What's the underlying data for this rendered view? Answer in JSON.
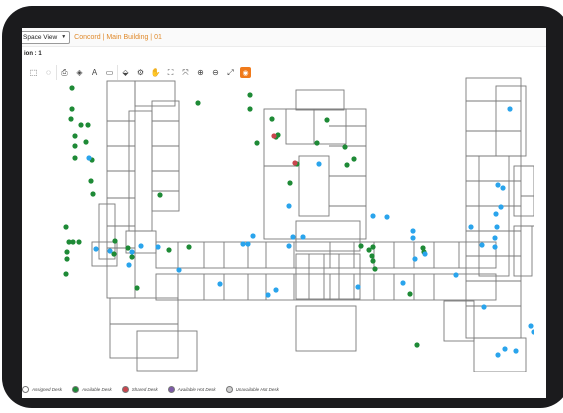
{
  "header": {
    "view_select": "Space View",
    "breadcrumb": "Concord | Main Building | 01"
  },
  "subbar": {
    "label": "ion : 1"
  },
  "toolbar": {
    "tools": [
      {
        "name": "select-tool-icon",
        "glyph": "⬚"
      },
      {
        "name": "rotate-tool-icon",
        "glyph": "◌"
      },
      {
        "name": "print-icon",
        "glyph": "⎙"
      },
      {
        "name": "layers-icon",
        "glyph": "◈"
      },
      {
        "name": "text-tool-icon",
        "glyph": "A"
      },
      {
        "name": "measure-tool-icon",
        "glyph": "▭"
      },
      {
        "name": "fill-tool-icon",
        "glyph": "⬙"
      },
      {
        "name": "settings-icon",
        "glyph": "⚙"
      },
      {
        "name": "pan-hand-icon",
        "glyph": "✋"
      },
      {
        "name": "fit-view-icon",
        "glyph": "⛶"
      },
      {
        "name": "fit-selection-icon",
        "glyph": "⤧"
      },
      {
        "name": "zoom-in-icon",
        "glyph": "⊕"
      },
      {
        "name": "zoom-out-icon",
        "glyph": "⊖"
      },
      {
        "name": "fullscreen-icon",
        "glyph": "⤢"
      },
      {
        "name": "layer-highlight-icon",
        "glyph": "◉"
      }
    ]
  },
  "colors": {
    "available": "#1e8a36",
    "shared": "#c8464e",
    "hot": "#7c5aa8",
    "unavailable": "#cfcfcf",
    "blue_desk": "#2aa4ec",
    "accent": "#f07a1b"
  },
  "desks": {
    "green": [
      [
        58,
        32
      ],
      [
        58,
        53
      ],
      [
        57,
        63
      ],
      [
        67,
        69
      ],
      [
        74,
        69
      ],
      [
        61,
        80
      ],
      [
        72,
        86
      ],
      [
        61,
        90
      ],
      [
        61,
        102
      ],
      [
        78,
        104
      ],
      [
        77,
        125
      ],
      [
        79,
        138
      ],
      [
        52,
        171
      ],
      [
        55,
        186
      ],
      [
        59,
        186
      ],
      [
        65,
        186
      ],
      [
        53,
        196
      ],
      [
        53,
        203
      ],
      [
        52,
        218
      ],
      [
        101,
        185
      ],
      [
        100,
        198
      ],
      [
        114,
        192
      ],
      [
        118,
        201
      ],
      [
        123,
        232
      ],
      [
        146,
        139
      ],
      [
        155,
        194
      ],
      [
        175,
        191
      ],
      [
        184,
        47
      ],
      [
        236,
        39
      ],
      [
        236,
        53
      ],
      [
        243,
        87
      ],
      [
        264,
        79
      ],
      [
        283,
        108
      ],
      [
        276,
        127
      ],
      [
        313,
        64
      ],
      [
        303,
        87
      ],
      [
        331,
        91
      ],
      [
        333,
        109
      ],
      [
        340,
        103
      ],
      [
        347,
        190
      ],
      [
        355,
        194
      ],
      [
        358,
        200
      ],
      [
        359,
        205
      ],
      [
        361,
        213
      ],
      [
        359,
        191
      ],
      [
        396,
        238
      ],
      [
        403,
        289
      ],
      [
        409,
        192
      ],
      [
        410,
        196
      ],
      [
        258,
        63
      ],
      [
        262,
        81
      ]
    ],
    "blue": [
      [
        75,
        102
      ],
      [
        82,
        193
      ],
      [
        96,
        195
      ],
      [
        115,
        209
      ],
      [
        118,
        196
      ],
      [
        127,
        190
      ],
      [
        144,
        191
      ],
      [
        165,
        214
      ],
      [
        206,
        228
      ],
      [
        229,
        188
      ],
      [
        234,
        188
      ],
      [
        239,
        180
      ],
      [
        254,
        239
      ],
      [
        262,
        234
      ],
      [
        275,
        150
      ],
      [
        275,
        190
      ],
      [
        279,
        181
      ],
      [
        289,
        181
      ],
      [
        305,
        108
      ],
      [
        344,
        231
      ],
      [
        359,
        160
      ],
      [
        373,
        161
      ],
      [
        389,
        227
      ],
      [
        399,
        175
      ],
      [
        399,
        182
      ],
      [
        401,
        203
      ],
      [
        411,
        198
      ],
      [
        442,
        219
      ],
      [
        457,
        171
      ],
      [
        468,
        189
      ],
      [
        470,
        251
      ],
      [
        484,
        299
      ],
      [
        491,
        293
      ],
      [
        502,
        295
      ],
      [
        520,
        276
      ],
      [
        517,
        270
      ],
      [
        484,
        129
      ],
      [
        487,
        151
      ],
      [
        482,
        158
      ],
      [
        489,
        132
      ],
      [
        483,
        171
      ],
      [
        481,
        182
      ],
      [
        481,
        191
      ],
      [
        496,
        53
      ]
    ],
    "red": [
      [
        260,
        80
      ],
      [
        281,
        107
      ]
    ]
  },
  "legend": [
    {
      "key": "assigned",
      "label": "Assigned Desk",
      "color": "#ffffff"
    },
    {
      "key": "available",
      "label": "Available Desk",
      "color": "#1e8a36"
    },
    {
      "key": "shared",
      "label": "Shared Desk",
      "color": "#c8464e"
    },
    {
      "key": "hot",
      "label": "Available Hot Desk",
      "color": "#7c5aa8"
    },
    {
      "key": "unavailable",
      "label": "Unavailable Hot Desk",
      "color": "#cfcfcf"
    }
  ]
}
